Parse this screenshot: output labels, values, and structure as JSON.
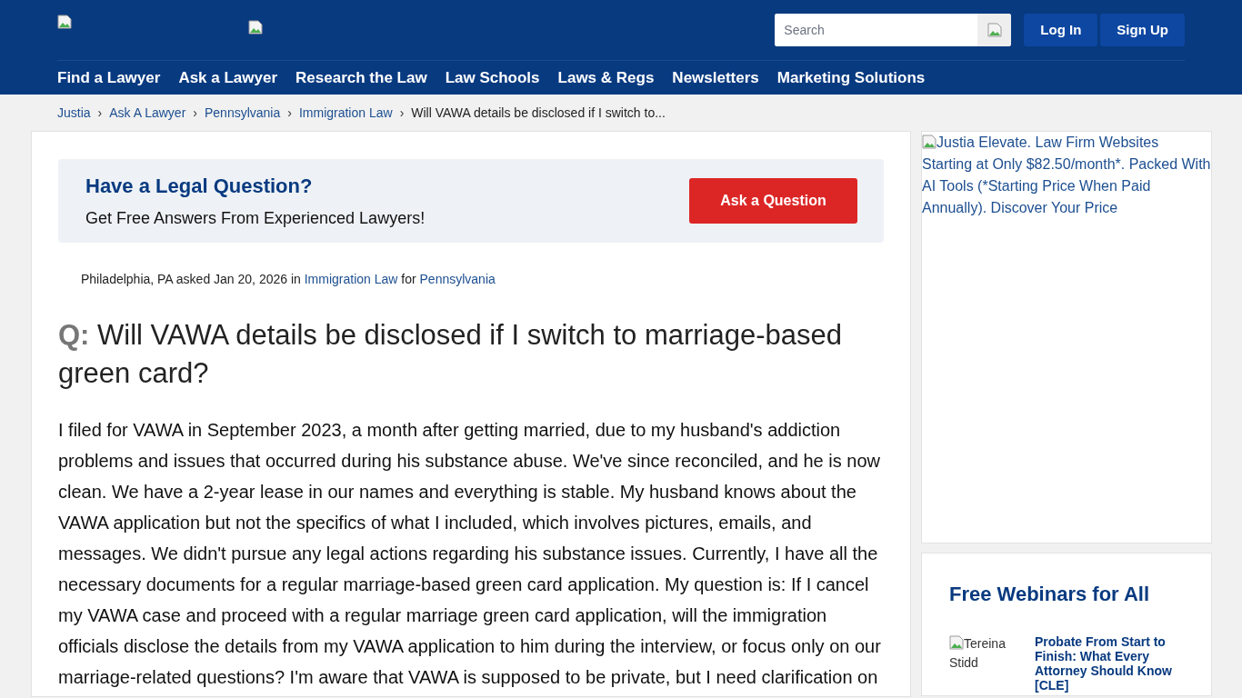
{
  "header": {
    "search": {
      "placeholder": "Search"
    },
    "buttons": [
      "Log In",
      "Sign Up"
    ],
    "nav": [
      "Find a Lawyer",
      "Ask a Lawyer",
      "Research the Law",
      "Law Schools",
      "Laws & Regs",
      "Newsletters",
      "Marketing Solutions"
    ]
  },
  "breadcrumbs": [
    {
      "label": "Justia",
      "link": true
    },
    {
      "label": "Ask A Lawyer",
      "link": true
    },
    {
      "label": "Pennsylvania",
      "link": true
    },
    {
      "label": "Immigration Law",
      "link": true
    },
    {
      "label": "Will VAWA details be disclosed if I switch to...",
      "link": false
    }
  ],
  "separator": "›",
  "promo": {
    "title": "Have a Legal Question?",
    "subtitle": "Get Free Answers From Experienced Lawyers!",
    "button": "Ask a Question"
  },
  "question": {
    "meta_prefix": "Philadelphia, PA asked Jan 20, 2026 in",
    "practice_area": "Immigration Law",
    "meta_mid": "for",
    "state": "Pennsylvania",
    "q_label": "Q:",
    "title": "Will VAWA details be disclosed if I switch to marriage-based green card?",
    "body": "I filed for VAWA in September 2023, a month after getting married, due to my husband's addiction problems and issues that occurred during his substance abuse. We've since reconciled, and he is now clean. We have a 2-year lease in our names and everything is stable. My husband knows about the VAWA application but not the specifics of what I included, which involves pictures, emails, and messages. We didn't pursue any legal actions regarding his substance issues. Currently, I have all the necessary documents for a regular marriage-based green card application. My question is: If I cancel my VAWA case and proceed with a regular marriage green card application, will the immigration officials disclose the details from my VAWA application to him during the interview, or focus only on our marriage-related questions? I'm aware that VAWA is supposed to be private, but I need clarification on"
  },
  "sidebar": {
    "ad_alt": "Justia Elevate. Law Firm Websites Starting at Only $82.50/month*. Packed With AI Tools (*Starting Price When Paid Annually). Discover Your Price",
    "webinars": {
      "title": "Free Webinars for All",
      "items": [
        {
          "image_alt": "Tereina Stidd",
          "title": "Probate From Start to Finish: What Every Attorney Should Know [CLE]"
        }
      ]
    }
  }
}
